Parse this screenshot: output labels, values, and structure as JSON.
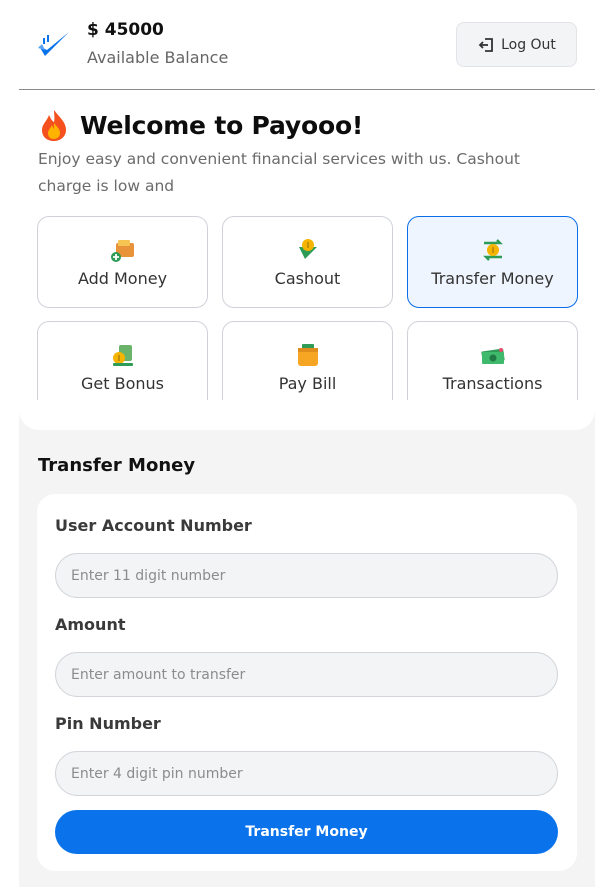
{
  "header": {
    "balance": "$ 45000",
    "balance_label": "Available Balance",
    "logout_label": "Log Out",
    "logo_icon": "payooo-logo-icon",
    "logout_icon": "logout-arrow-icon"
  },
  "welcome": {
    "title": "Welcome to Payooo!",
    "icon": "fire-icon",
    "subtitle": "Enjoy easy and convenient financial services with us. Cashout charge is low and"
  },
  "services": [
    {
      "label": "Add Money",
      "icon": "wallet-add-icon",
      "active": false
    },
    {
      "label": "Cashout",
      "icon": "cashout-icon",
      "active": false
    },
    {
      "label": "Transfer Money",
      "icon": "transfer-coin-icon",
      "active": true
    },
    {
      "label": "Get Bonus",
      "icon": "bonus-icon",
      "active": false
    },
    {
      "label": "Pay Bill",
      "icon": "bill-wallet-icon",
      "active": false
    },
    {
      "label": "Transactions",
      "icon": "cash-stack-icon",
      "active": false
    }
  ],
  "form": {
    "title": "Transfer Money",
    "account_label": "User Account Number",
    "account_placeholder": "Enter 11 digit number",
    "amount_label": "Amount",
    "amount_placeholder": "Enter amount to transfer",
    "pin_label": "Pin Number",
    "pin_placeholder": "Enter 4 digit pin number",
    "submit_label": "Transfer Money"
  },
  "colors": {
    "accent": "#0a73ec",
    "active_tile_bg": "#eef5fe",
    "panel_bg": "#f4f4f5"
  }
}
